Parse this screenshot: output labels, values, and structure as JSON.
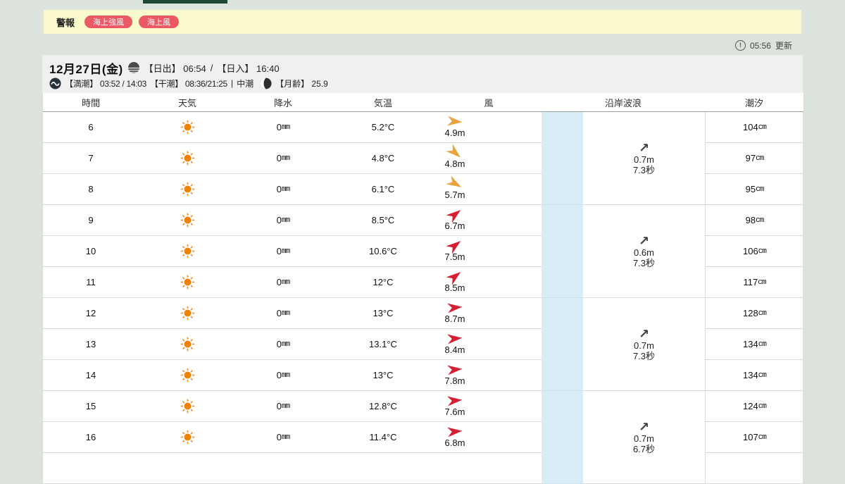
{
  "colors": {
    "page_bg": "#dce2dc",
    "banner_bg": "#f9f9cb",
    "pill_red": "#eb5a64",
    "tab_green": "#1b4733",
    "band_gray": "#f0f0f0",
    "blue_column": "#d9edf6",
    "wind_orange": "#e9a338",
    "wind_red": "#d81e33",
    "sun_orange": "#ef8200"
  },
  "alert": {
    "label": "警報",
    "badges": [
      "海上強風",
      "海上風"
    ]
  },
  "update": {
    "time": "05:56",
    "label": "更新"
  },
  "date_header": {
    "date": "12月27日(金)",
    "sunrise": "【日出】 06:54",
    "sep": "/",
    "sunset": "【日入】 16:40",
    "high_tide": "【満潮】 03:52 / 14:03",
    "low_tide": "【干潮】 08:36/21:25",
    "divider": "|",
    "phase": "中潮",
    "moon": "【月齢】 25.9"
  },
  "table": {
    "headers": [
      "時間",
      "天気",
      "降水",
      "気温",
      "風",
      "沿岸波浪",
      "潮汐"
    ],
    "units": {
      "precip": "mm",
      "tide": "cm"
    },
    "weather_icon": "sun-icon",
    "rows": [
      {
        "hour": "6",
        "weather": "sunny",
        "precip": "0",
        "temp": "5.2°C",
        "wind_speed": "4.9m",
        "wind_deg": 5,
        "wind_level": "orange",
        "tide": "104"
      },
      {
        "hour": "7",
        "weather": "sunny",
        "precip": "0",
        "temp": "4.8°C",
        "wind_speed": "4.8m",
        "wind_deg": 42,
        "wind_level": "orange",
        "tide": "97"
      },
      {
        "hour": "8",
        "weather": "sunny",
        "precip": "0",
        "temp": "6.1°C",
        "wind_speed": "5.7m",
        "wind_deg": 30,
        "wind_level": "orange",
        "tide": "95"
      },
      {
        "hour": "9",
        "weather": "sunny",
        "precip": "0",
        "temp": "8.5°C",
        "wind_speed": "6.7m",
        "wind_deg": -38,
        "wind_level": "red",
        "tide": "98"
      },
      {
        "hour": "10",
        "weather": "sunny",
        "precip": "0",
        "temp": "10.6°C",
        "wind_speed": "7.5m",
        "wind_deg": -38,
        "wind_level": "red",
        "tide": "106"
      },
      {
        "hour": "11",
        "weather": "sunny",
        "precip": "0",
        "temp": "12°C",
        "wind_speed": "8.5m",
        "wind_deg": -38,
        "wind_level": "red",
        "tide": "117"
      },
      {
        "hour": "12",
        "weather": "sunny",
        "precip": "0",
        "temp": "13°C",
        "wind_speed": "8.7m",
        "wind_deg": -5,
        "wind_level": "red",
        "tide": "128"
      },
      {
        "hour": "13",
        "weather": "sunny",
        "precip": "0",
        "temp": "13.1°C",
        "wind_speed": "8.4m",
        "wind_deg": -5,
        "wind_level": "red",
        "tide": "134"
      },
      {
        "hour": "14",
        "weather": "sunny",
        "precip": "0",
        "temp": "13°C",
        "wind_speed": "7.8m",
        "wind_deg": -5,
        "wind_level": "red",
        "tide": "134"
      },
      {
        "hour": "15",
        "weather": "sunny",
        "precip": "0",
        "temp": "12.8°C",
        "wind_speed": "7.6m",
        "wind_deg": -5,
        "wind_level": "red",
        "tide": "124"
      },
      {
        "hour": "16",
        "weather": "sunny",
        "precip": "0",
        "temp": "11.4°C",
        "wind_speed": "6.8m",
        "wind_deg": -5,
        "wind_level": "red",
        "tide": "107"
      }
    ],
    "wave_groups": [
      {
        "dir": "↗",
        "height": "0.7m",
        "period": "7.3秒"
      },
      {
        "dir": "↗",
        "height": "0.6m",
        "period": "7.3秒"
      },
      {
        "dir": "↗",
        "height": "0.7m",
        "period": "7.3秒"
      },
      {
        "dir": "↗",
        "height": "0.7m",
        "period": "6.7秒"
      }
    ]
  }
}
